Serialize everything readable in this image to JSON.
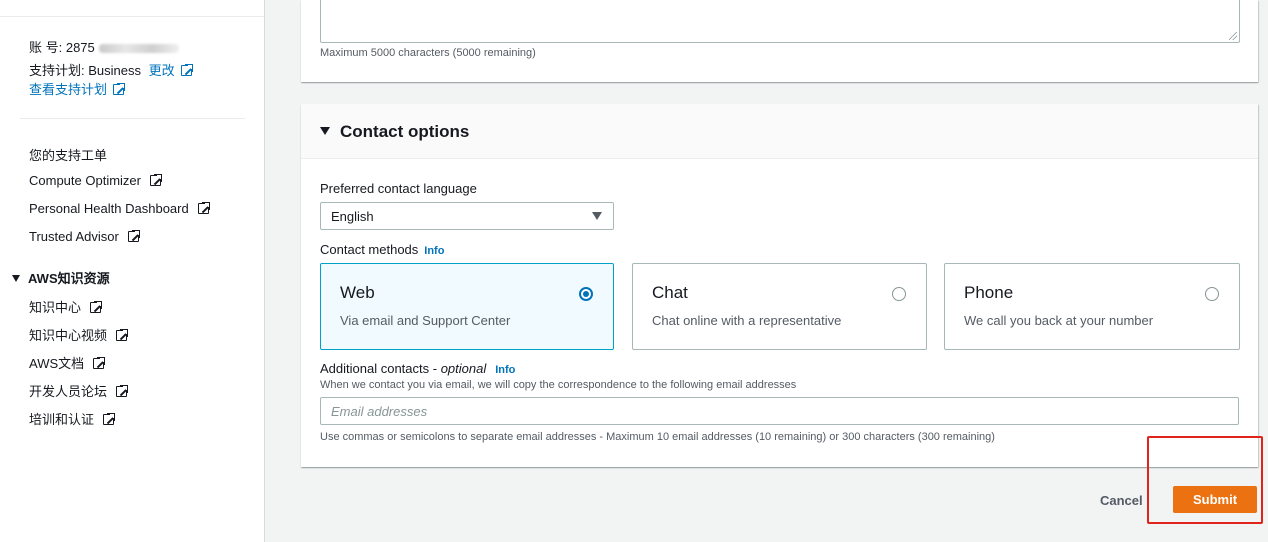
{
  "sidebar": {
    "account_label": "账 号: 2875",
    "support_plan_label": "支持计划: Business",
    "change_link": "更改",
    "view_plan_link": "查看支持计划",
    "nav_items": [
      {
        "label": "您的支持工单"
      },
      {
        "label": "Compute Optimizer"
      },
      {
        "label": "Personal Health Dashboard"
      },
      {
        "label": "Trusted Advisor"
      }
    ],
    "knowledge_section": "AWS知识资源",
    "knowledge_items": [
      {
        "label": "知识中心"
      },
      {
        "label": "知识中心视频"
      },
      {
        "label": "AWS文档"
      },
      {
        "label": "开发人员论坛"
      },
      {
        "label": "培训和认证"
      }
    ]
  },
  "description": {
    "hint": "Maximum 5000 characters (5000 remaining)"
  },
  "contact_options": {
    "title": "Contact options",
    "language_label": "Preferred contact language",
    "language_value": "English",
    "methods_label": "Contact methods",
    "info_label": "Info",
    "methods": [
      {
        "title": "Web",
        "description": "Via email and Support Center",
        "selected": true
      },
      {
        "title": "Chat",
        "description": "Chat online with a representative",
        "selected": false
      },
      {
        "title": "Phone",
        "description": "We call you back at your number",
        "selected": false
      }
    ],
    "additional_label": "Additional contacts - ",
    "additional_optional": "optional",
    "additional_desc": "When we contact you via email, we will copy the correspondence to the following email addresses",
    "email_placeholder": "Email addresses",
    "email_hint": "Use commas or semicolons to separate email addresses - Maximum 10 email addresses (10 remaining) or 300 characters (300 remaining)"
  },
  "actions": {
    "cancel_label": "Cancel",
    "submit_label": "Submit"
  },
  "colors": {
    "accent": "#0073bb",
    "primary_button": "#ec7211",
    "highlight": "#e0231b"
  }
}
